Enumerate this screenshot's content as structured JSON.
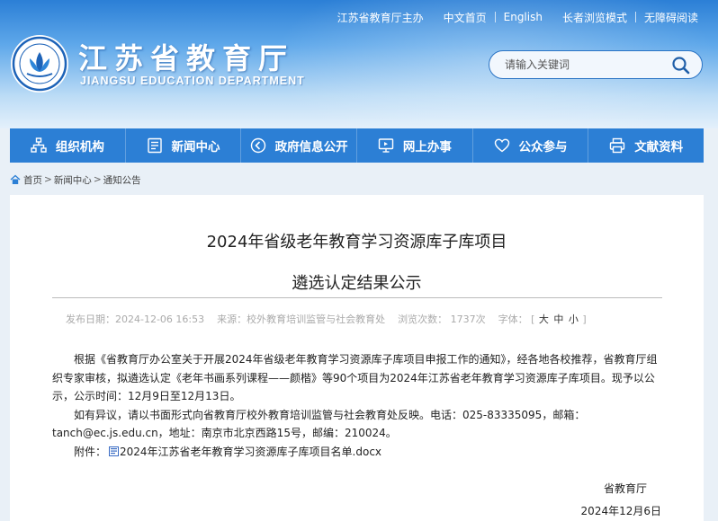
{
  "header": {
    "toplinks": {
      "host": "江苏省教育厅主办",
      "chinese_home": "中文首页",
      "english": "English",
      "elder_mode": "长者浏览模式",
      "accessible": "无障碍阅读"
    },
    "title": "江苏省教育厅",
    "subtitle": "JIANGSU EDUCATION DEPARTMENT",
    "search": {
      "placeholder": "请输入关键词"
    }
  },
  "nav": {
    "items": [
      {
        "label": "组织机构",
        "icon": "org-chart-icon"
      },
      {
        "label": "新闻中心",
        "icon": "news-icon"
      },
      {
        "label": "政府信息公开",
        "icon": "info-disclosure-icon"
      },
      {
        "label": "网上办事",
        "icon": "online-service-icon"
      },
      {
        "label": "公众参与",
        "icon": "heart-icon"
      },
      {
        "label": "文献资料",
        "icon": "printer-icon"
      }
    ]
  },
  "breadcrumb": {
    "items": [
      "首页",
      "新闻中心",
      "通知公告"
    ],
    "separator": ">"
  },
  "article": {
    "title_line1": "2024年省级老年教育学习资源库子库项目",
    "title_line2": "遴选认定结果公示",
    "meta": {
      "date": "发布日期：2024-12-06 16:53",
      "source": "来源：校外教育培训监管与社会教育处",
      "views": "浏览次数：  1737次",
      "font_label": "字体：",
      "bracket_open": "[",
      "bracket_close": "]",
      "size_large": "大",
      "size_medium": "中",
      "size_small": "小"
    },
    "paragraph1": "根据《省教育厅办公室关于开展2024年省级老年教育学习资源库子库项目申报工作的通知》，经各地各校推荐，省教育厅组织专家审核，拟遴选认定《老年书画系列课程——颜楷》等90个项目为2024年江苏省老年教育学习资源库子库项目。现予以公示，公示时间：12月9日至12月13日。",
    "paragraph2": "如有异议，请以书面形式向省教育厅校外教育培训监管与社会教育处反映。电话：025-83335095，邮箱：tanch@ec.js.edu.cn，地址：南京市北京西路15号，邮编：210024。",
    "attachment_label": "附件：",
    "attachment_name": "2024年江苏省老年教育学习资源库子库项目名单.docx",
    "signature": "省教育厅",
    "sign_date": "2024年12月6日"
  },
  "colors": {
    "nav_bg": "#2c7fd5",
    "header_top": "#2b7fd6",
    "page_bg": "#e9f0f7"
  }
}
